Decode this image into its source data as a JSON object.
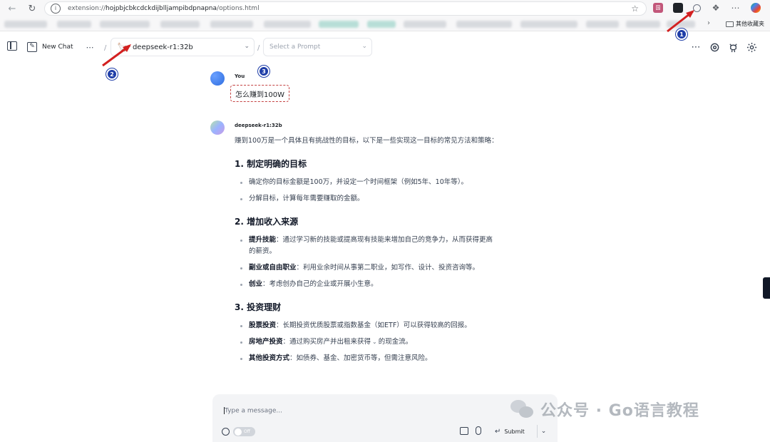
{
  "browser": {
    "url_prefix": "extension://",
    "url_host": "hojpbjcbkcdckdijblljampibdpnapna",
    "url_path": "/options.html",
    "ext_badge": "国",
    "other_bookmarks": "其他收藏夹"
  },
  "toolbar": {
    "new_chat_label": "New Chat",
    "model_name": "deepseek-r1:32b",
    "prompt_placeholder": "Select a Prompt"
  },
  "annotations": [
    "1",
    "2",
    "3"
  ],
  "chat": {
    "user_sender": "You",
    "user_message": "怎么赚到100W",
    "bot_sender": "deepseek-r1:32b",
    "intro": "赚到100万是一个具体且有挑战性的目标，以下是一些实现这一目标的常见方法和策略：",
    "sections": [
      {
        "heading": "1. 制定明确的目标",
        "items": [
          {
            "bold": "",
            "text": "确定你的目标金额是100万，并设定一个时间框架（例如5年、10年等）。"
          },
          {
            "bold": "",
            "text": "分解目标，计算每年需要赚取的金额。"
          }
        ]
      },
      {
        "heading": "2. 增加收入来源",
        "items": [
          {
            "bold": "提升技能",
            "text": "：通过学习新的技能或提高现有技能来增加自己的竞争力，从而获得更高的薪资。"
          },
          {
            "bold": "副业或自由职业",
            "text": "：利用业余时间从事第二职业，如写作、设计、投资咨询等。"
          },
          {
            "bold": "创业",
            "text": "：考虑创办自己的企业或开展小生意。"
          }
        ]
      },
      {
        "heading": "3. 投资理财",
        "items": [
          {
            "bold": "股票投资",
            "text": "：长期投资优质股票或指数基金（如ETF）可以获得较高的回报。"
          },
          {
            "bold": "房地产投资",
            "text": "：通过购买房产并出租来获得",
            "text2": "的现金流。"
          },
          {
            "bold": "其他投资方式",
            "text": "：如债券、基金、加密货币等，但需注意风险。"
          }
        ]
      }
    ]
  },
  "composer": {
    "placeholder": "Type a message...",
    "toggle_label": "Off",
    "submit_label": "Submit"
  },
  "watermark": {
    "text": "公众号 · Go语言教程"
  },
  "icons": {
    "back": "arrow-left-icon",
    "reload": "reload-icon",
    "star": "star-icon",
    "sidebar": "sidebar-toggle-icon",
    "pen": "edit-icon",
    "model": "llama-icon",
    "gear": "gear-icon",
    "github": "github-icon",
    "globe": "globe-icon",
    "image": "image-icon",
    "mic": "mic-icon"
  },
  "colors": {
    "annotation": "#1f3ea8",
    "arrow": "#d32020",
    "highlight_border": "#c44242"
  }
}
